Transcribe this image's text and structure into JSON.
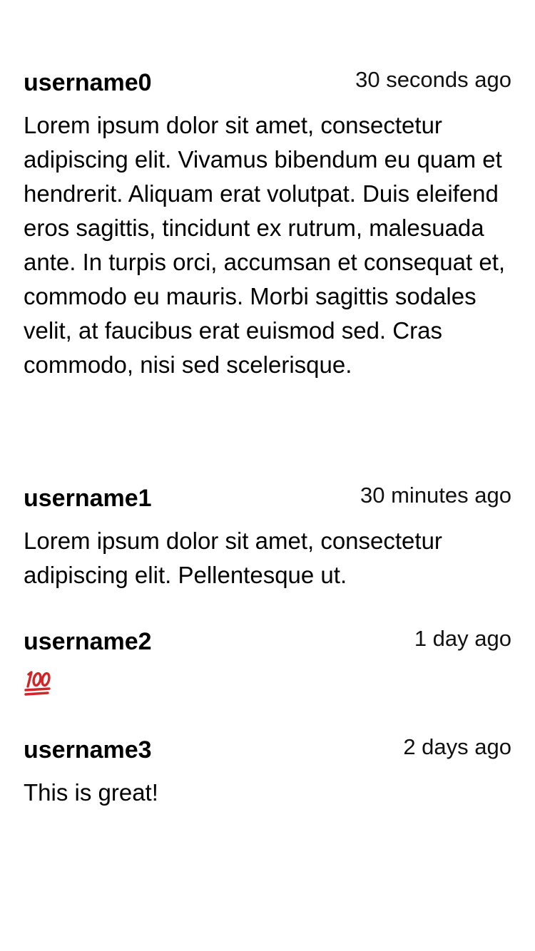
{
  "comments": [
    {
      "username": "username0",
      "time": "30 seconds ago",
      "body": "Lorem ipsum dolor sit amet, consectetur adipiscing elit. Vivamus bibendum eu quam et hendrerit. Aliquam erat volutpat. Duis eleifend eros sagittis, tincidunt ex rutrum, malesuada ante. In turpis orci, accumsan et consequat et, commodo eu mauris. Morbi sagittis sodales velit, at faucibus erat euismod sed. Cras commodo, nisi sed scelerisque."
    },
    {
      "username": "username1",
      "time": "30 minutes ago",
      "body": "Lorem ipsum dolor sit amet, consectetur adipiscing elit. Pellentesque ut."
    },
    {
      "username": "username2",
      "time": "1 day ago",
      "body_icon": "hundred-points-icon",
      "body_icon_color": "#d0262a"
    },
    {
      "username": "username3",
      "time": "2 days ago",
      "body": "This is great!"
    }
  ]
}
